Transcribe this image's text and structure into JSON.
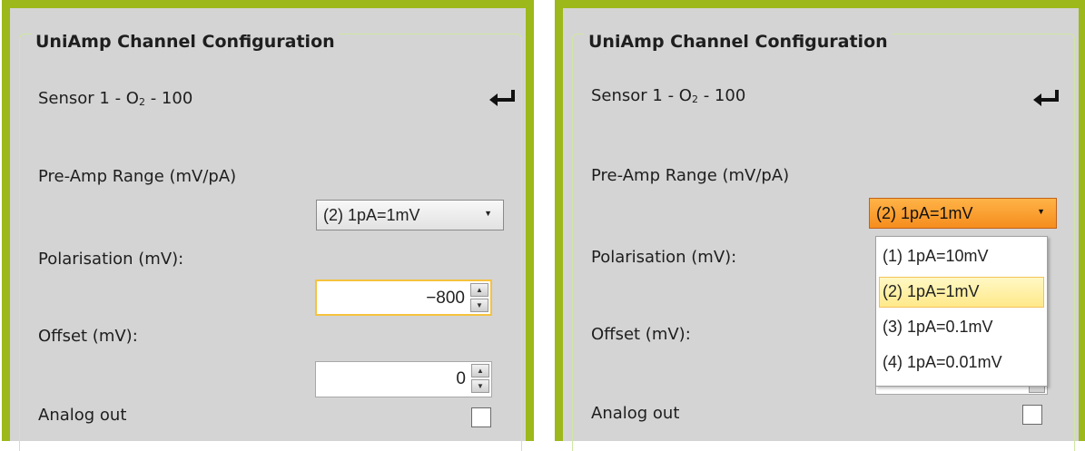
{
  "left": {
    "group_title": "UniAmp Channel Configuration",
    "sensor": {
      "prefix": "Sensor 1 - O",
      "subscript": "2",
      "suffix": " - 100"
    },
    "preamp_label": "Pre-Amp Range (mV/pA)",
    "preamp_value": "(2) 1pA=1mV",
    "polarisation_label": "Polarisation (mV):",
    "polarisation_value": "−800",
    "offset_label": "Offset (mV):",
    "offset_value": "0",
    "analog_label": "Analog out"
  },
  "right": {
    "group_title": "UniAmp Channel Configuration",
    "sensor": {
      "prefix": "Sensor 1 - O",
      "subscript": "2",
      "suffix": " - 100"
    },
    "preamp_label": "Pre-Amp Range (mV/pA)",
    "preamp_value": "(2) 1pA=1mV",
    "polarisation_label": "Polarisation (mV):",
    "offset_label": "Offset (mV):",
    "analog_label": "Analog out",
    "dropdown_options": [
      "(1) 1pA=10mV",
      "(2) 1pA=1mV",
      "(3) 1pA=0.1mV",
      "(4) 1pA=0.01mV"
    ],
    "dropdown_selected_index": 1
  },
  "icons": {
    "enter": "enter-return-icon",
    "dropdown": "dropdown-arrow-icon",
    "spin_up": "spin-up-icon",
    "spin_down": "spin-down-icon"
  },
  "colors": {
    "frame": "#9cb81a",
    "group_border": "#d0e7a2",
    "panel_bg": "#d4d4d4",
    "combo_open": "#f58d1e",
    "selection": "#ffe98a",
    "focus": "#f6c23e"
  }
}
